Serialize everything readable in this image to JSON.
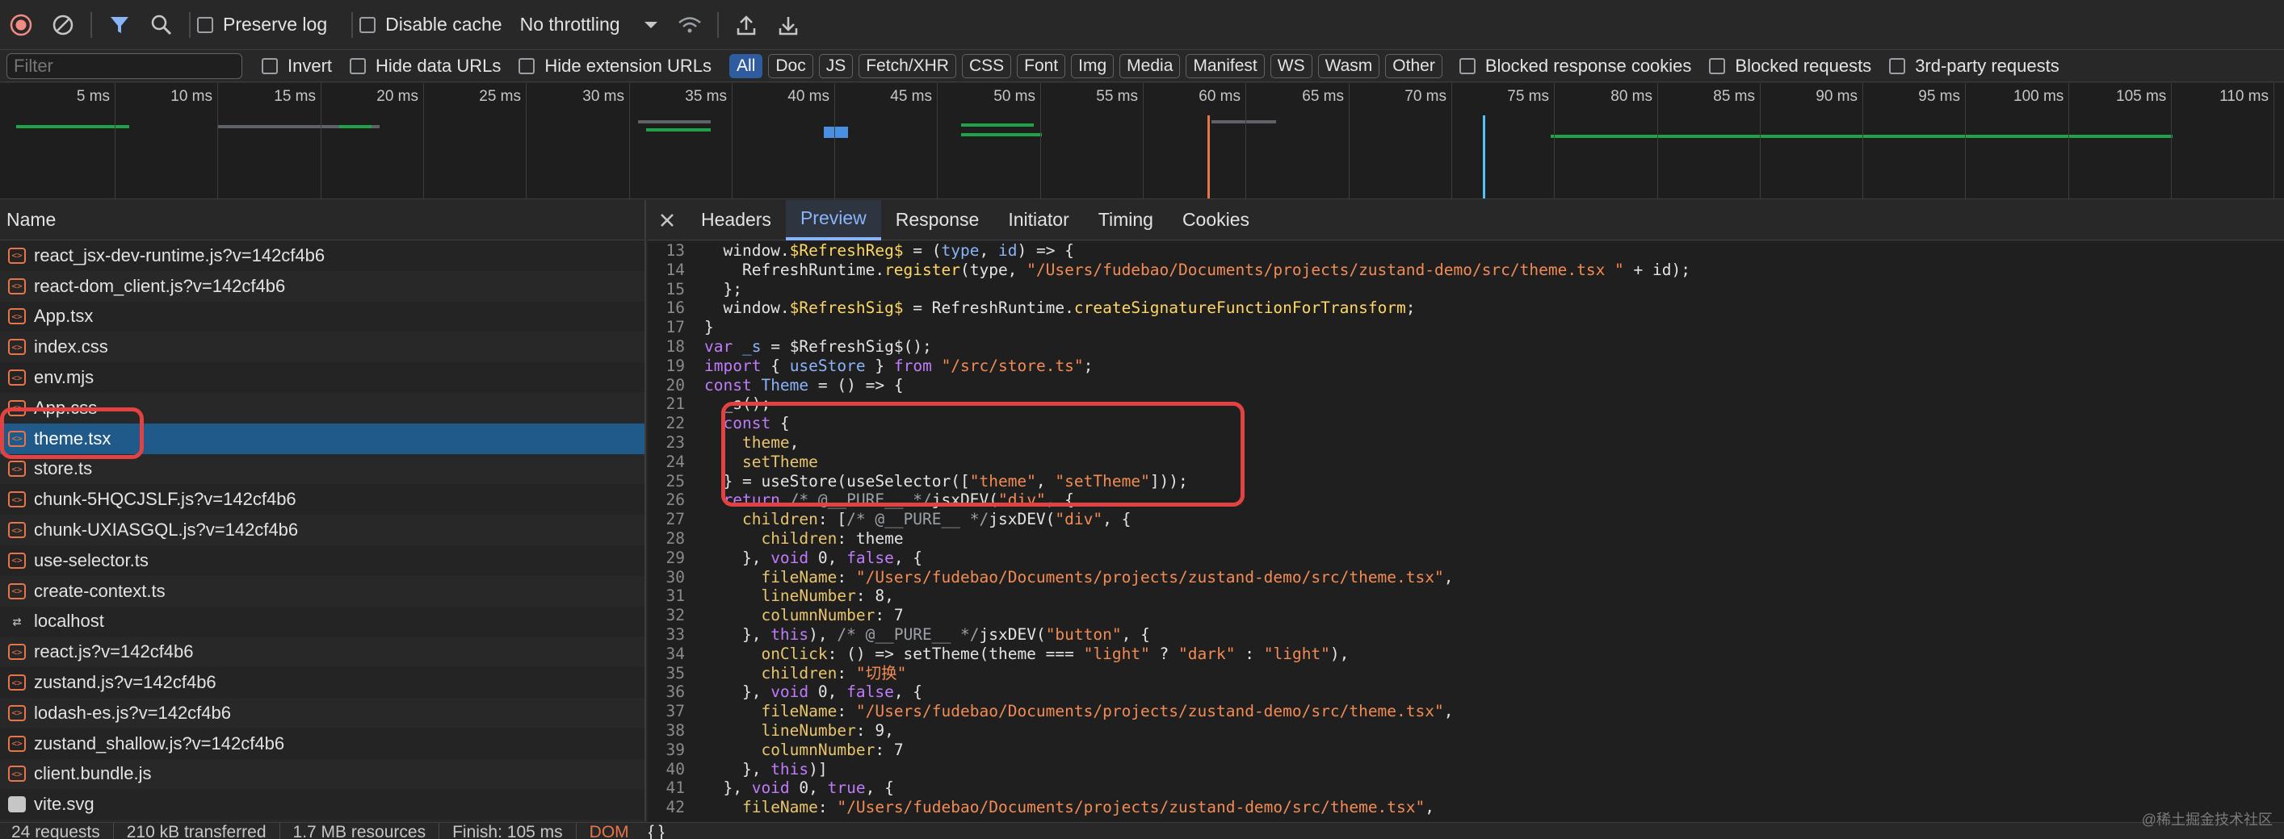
{
  "toolbar": {
    "preserve_log": "Preserve log",
    "disable_cache": "Disable cache",
    "throttling": "No throttling"
  },
  "filterbar": {
    "placeholder": "Filter",
    "invert": "Invert",
    "hide_data_urls": "Hide data URLs",
    "hide_extension_urls": "Hide extension URLs",
    "types": [
      "All",
      "Doc",
      "JS",
      "Fetch/XHR",
      "CSS",
      "Font",
      "Img",
      "Media",
      "Manifest",
      "WS",
      "Wasm",
      "Other"
    ],
    "blocked_cookies": "Blocked response cookies",
    "blocked_requests": "Blocked requests",
    "third_party": "3rd-party requests"
  },
  "overview": {
    "ticks": [
      "5 ms",
      "10 ms",
      "15 ms",
      "20 ms",
      "25 ms",
      "30 ms",
      "35 ms",
      "40 ms",
      "45 ms",
      "50 ms",
      "55 ms",
      "60 ms",
      "65 ms",
      "70 ms",
      "75 ms",
      "80 ms",
      "85 ms",
      "90 ms",
      "95 ms",
      "100 ms",
      "105 ms",
      "110 ms"
    ]
  },
  "requests": {
    "header": "Name",
    "items": [
      {
        "name": "react_jsx-dev-runtime.js?v=142cf4b6",
        "type": "js"
      },
      {
        "name": "react-dom_client.js?v=142cf4b6",
        "type": "js"
      },
      {
        "name": "App.tsx",
        "type": "js"
      },
      {
        "name": "index.css",
        "type": "js"
      },
      {
        "name": "env.mjs",
        "type": "js"
      },
      {
        "name": "App.css",
        "type": "js"
      },
      {
        "name": "theme.tsx",
        "type": "js",
        "selected": true
      },
      {
        "name": "store.ts",
        "type": "js"
      },
      {
        "name": "chunk-5HQCJSLF.js?v=142cf4b6",
        "type": "js"
      },
      {
        "name": "chunk-UXIASGQL.js?v=142cf4b6",
        "type": "js"
      },
      {
        "name": "use-selector.ts",
        "type": "js"
      },
      {
        "name": "create-context.ts",
        "type": "js"
      },
      {
        "name": "localhost",
        "type": "ws"
      },
      {
        "name": "react.js?v=142cf4b6",
        "type": "js"
      },
      {
        "name": "zustand.js?v=142cf4b6",
        "type": "js"
      },
      {
        "name": "lodash-es.js?v=142cf4b6",
        "type": "js"
      },
      {
        "name": "zustand_shallow.js?v=142cf4b6",
        "type": "js"
      },
      {
        "name": "client.bundle.js",
        "type": "js"
      },
      {
        "name": "vite.svg",
        "type": "svg"
      }
    ]
  },
  "tabs": [
    "Headers",
    "Preview",
    "Response",
    "Initiator",
    "Timing",
    "Cookies"
  ],
  "code_lines": [
    {
      "n": "13",
      "html": "  window.<span class='f'>$RefreshReg$</span> = (<span class='v'>type</span>, <span class='v'>id</span>) => {"
    },
    {
      "n": "14",
      "html": "    RefreshRuntime.<span class='f'>register</span>(type, <span class='s'>\"/Users/fudebao/Documents/projects/zustand-demo/src/theme.tsx \"</span> + id);"
    },
    {
      "n": "15",
      "html": "  };"
    },
    {
      "n": "16",
      "html": "  window.<span class='f'>$RefreshSig$</span> = RefreshRuntime.<span class='f'>createSignatureFunctionForTransform</span>;"
    },
    {
      "n": "17",
      "html": "}"
    },
    {
      "n": "18",
      "html": "<span class='k'>var</span> <span class='v'>_s</span> = $RefreshSig$();"
    },
    {
      "n": "19",
      "html": "<span class='k'>import</span> { <span class='v'>useStore</span> } <span class='k'>from</span> <span class='s'>\"/src/store.ts\"</span>;"
    },
    {
      "n": "20",
      "html": "<span class='k'>const</span> <span class='v'>Theme</span> = () => {"
    },
    {
      "n": "21",
      "html": "  _s();"
    },
    {
      "n": "22",
      "html": "  <span class='k'>const</span> {"
    },
    {
      "n": "23",
      "html": "    <span class='p'>theme</span>,"
    },
    {
      "n": "24",
      "html": "    <span class='p'>setTheme</span>"
    },
    {
      "n": "25",
      "html": "  } = useStore(useSelector([<span class='s'>\"theme\"</span>, <span class='s'>\"setTheme\"</span>]));"
    },
    {
      "n": "26",
      "html": "  <span class='k'>return</span> <span class='c'>/* @__PURE__ */</span>jsxDEV(<span class='s'>\"div\"</span>, {"
    },
    {
      "n": "27",
      "html": "    <span class='p'>children</span>: [<span class='c'>/* @__PURE__ */</span>jsxDEV(<span class='s'>\"div\"</span>, {"
    },
    {
      "n": "28",
      "html": "      <span class='p'>children</span>: theme"
    },
    {
      "n": "29",
      "html": "    }, <span class='k'>void</span> 0, <span class='k'>false</span>, {"
    },
    {
      "n": "30",
      "html": "      <span class='p'>fileName</span>: <span class='s'>\"/Users/fudebao/Documents/projects/zustand-demo/src/theme.tsx\"</span>,"
    },
    {
      "n": "31",
      "html": "      <span class='p'>lineNumber</span>: 8,"
    },
    {
      "n": "32",
      "html": "      <span class='p'>columnNumber</span>: 7"
    },
    {
      "n": "33",
      "html": "    }, <span class='k'>this</span>), <span class='c'>/* @__PURE__ */</span>jsxDEV(<span class='s'>\"button\"</span>, {"
    },
    {
      "n": "34",
      "html": "      <span class='p'>onClick</span>: () => setTheme(theme === <span class='s'>\"light\"</span> ? <span class='s'>\"dark\"</span> : <span class='s'>\"light\"</span>),"
    },
    {
      "n": "35",
      "html": "      <span class='p'>children</span>: <span class='s'>\"切换\"</span>"
    },
    {
      "n": "36",
      "html": "    }, <span class='k'>void</span> 0, <span class='k'>false</span>, {"
    },
    {
      "n": "37",
      "html": "      <span class='p'>fileName</span>: <span class='s'>\"/Users/fudebao/Documents/projects/zustand-demo/src/theme.tsx\"</span>,"
    },
    {
      "n": "38",
      "html": "      <span class='p'>lineNumber</span>: 9,"
    },
    {
      "n": "39",
      "html": "      <span class='p'>columnNumber</span>: 7"
    },
    {
      "n": "40",
      "html": "    }, <span class='k'>this</span>)]"
    },
    {
      "n": "41",
      "html": "  }, <span class='k'>void</span> 0, <span class='k'>true</span>, {"
    },
    {
      "n": "42",
      "html": "    <span class='p'>fileName</span>: <span class='s'>\"/Users/fudebao/Documents/projects/zustand-demo/src/theme.tsx\"</span>,"
    }
  ],
  "status": {
    "requests": "24 requests",
    "transferred": "210 kB transferred",
    "resources": "1.7 MB resources",
    "finish": "Finish: 105 ms",
    "dom": "DOM",
    "braces": "{ }"
  },
  "watermark": "@稀土掘金技术社区",
  "colors": {
    "accent": "#8ab4f8",
    "highlight": "#e34242",
    "selected_row": "#1f5a8a"
  }
}
